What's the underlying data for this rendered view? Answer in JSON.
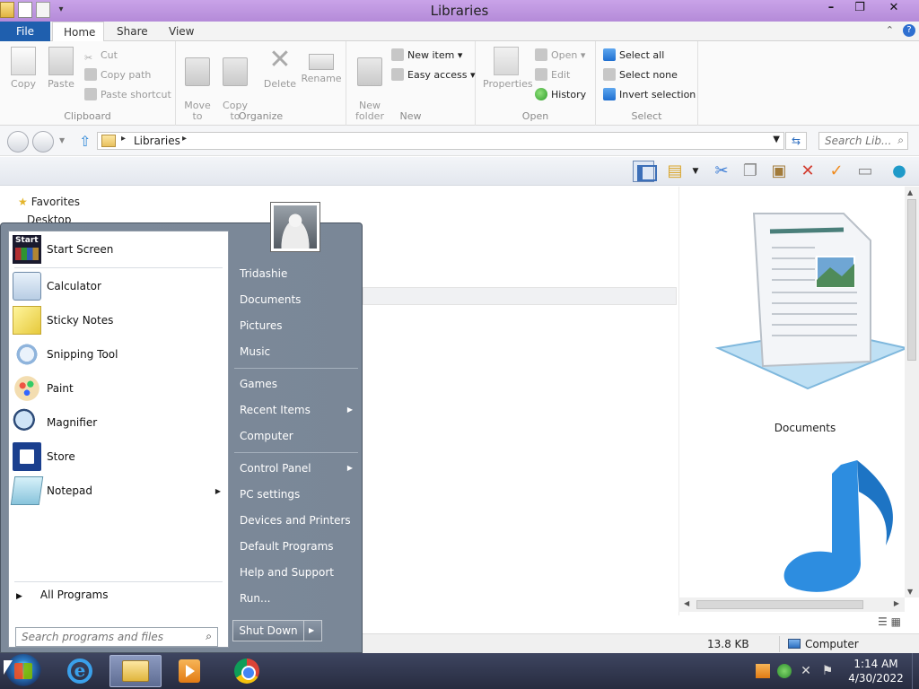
{
  "window": {
    "title": "Libraries"
  },
  "ribbon": {
    "tabs": [
      "File",
      "Home",
      "Share",
      "View"
    ],
    "groups": {
      "clipboard": {
        "label": "Clipboard",
        "copy": "Copy",
        "paste": "Paste",
        "cut": "Cut",
        "copy_path": "Copy path",
        "paste_shortcut": "Paste shortcut"
      },
      "organize": {
        "label": "Organize",
        "move_to": "Move\nto",
        "copy_to": "Copy\nto",
        "delete": "Delete",
        "rename": "Rename"
      },
      "new": {
        "label": "New",
        "new_folder": "New\nfolder",
        "new_item": "New item",
        "easy_access": "Easy access"
      },
      "open": {
        "label": "Open",
        "properties": "Properties",
        "open": "Open",
        "edit": "Edit",
        "history": "History"
      },
      "select": {
        "label": "Select",
        "select_all": "Select all",
        "select_none": "Select none",
        "invert_selection": "Invert selection"
      }
    }
  },
  "address": {
    "breadcrumb": [
      "Libraries"
    ],
    "search_placeholder": "Search Lib..."
  },
  "nav": {
    "favorites": "Favorites",
    "desktop": "Desktop"
  },
  "content": {
    "preview_label": "Documents"
  },
  "status": {
    "size": "13.8 KB",
    "location": "Computer"
  },
  "start_menu": {
    "pinned": [
      {
        "label": "Start Screen",
        "icon": "start-screen-icon"
      },
      {
        "label": "Calculator",
        "icon": "calculator-icon"
      },
      {
        "label": "Sticky Notes",
        "icon": "sticky-notes-icon"
      },
      {
        "label": "Snipping Tool",
        "icon": "snipping-tool-icon"
      },
      {
        "label": "Paint",
        "icon": "paint-icon"
      },
      {
        "label": "Magnifier",
        "icon": "magnifier-icon"
      },
      {
        "label": "Store",
        "icon": "store-icon"
      },
      {
        "label": "Notepad",
        "icon": "notepad-icon"
      }
    ],
    "all_programs": "All Programs",
    "search_placeholder": "Search programs and files",
    "start_icon_text": "Start",
    "right": {
      "user": "Tridashie",
      "documents": "Documents",
      "pictures": "Pictures",
      "music": "Music",
      "games": "Games",
      "recent_items": "Recent Items",
      "computer": "Computer",
      "control_panel": "Control Panel",
      "pc_settings": "PC settings",
      "devices_printers": "Devices and Printers",
      "default_programs": "Default Programs",
      "help_support": "Help and Support",
      "run": "Run..."
    },
    "shutdown": "Shut Down"
  },
  "taskbar": {
    "apps": [
      "internet-explorer-icon",
      "file-explorer-icon",
      "media-player-icon",
      "chrome-icon"
    ],
    "time": "1:14 AM",
    "date": "4/30/2022"
  }
}
